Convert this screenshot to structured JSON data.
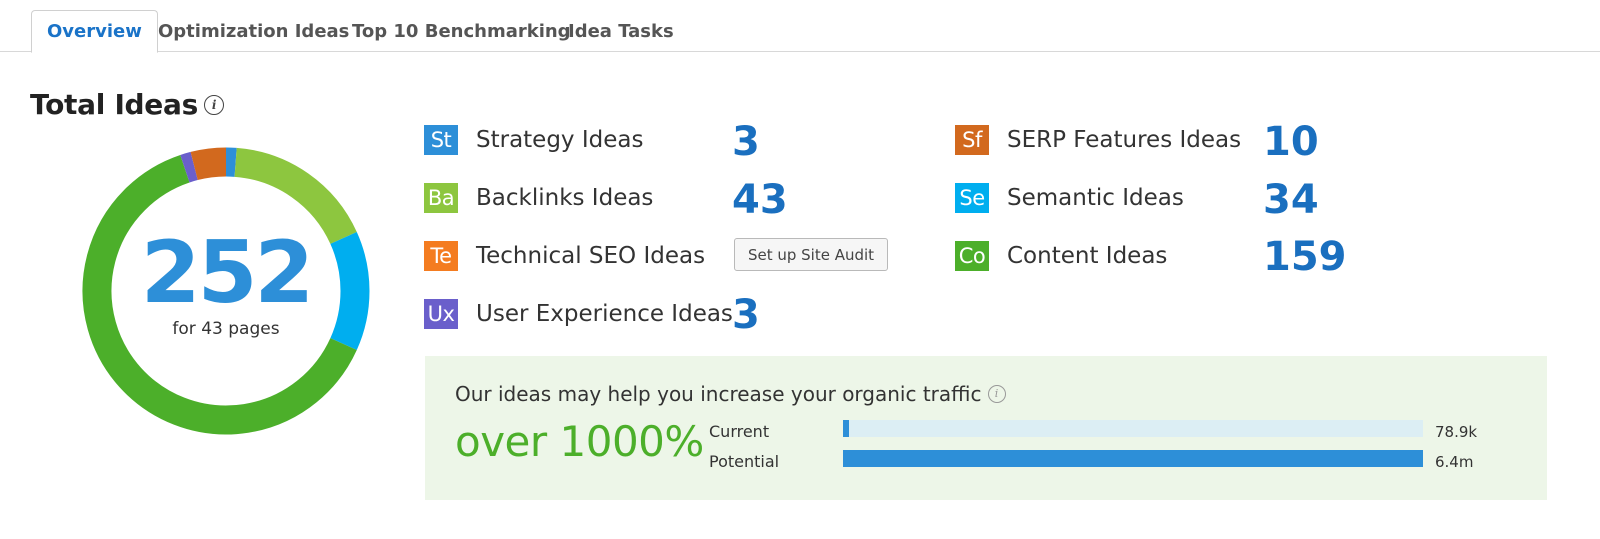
{
  "tabs": [
    {
      "label": "Overview",
      "active": true
    },
    {
      "label": "Optimization Ideas",
      "active": false
    },
    {
      "label": "Top 10 Benchmarking",
      "active": false
    },
    {
      "label": "Idea Tasks",
      "active": false
    }
  ],
  "summary": {
    "title": "Total Ideas",
    "total": "252",
    "pages_label": "for 43 pages"
  },
  "ideas": [
    {
      "badge": "St",
      "label": "Strategy Ideas",
      "count": "3",
      "color": "#2d8fd8"
    },
    {
      "badge": "Ba",
      "label": "Backlinks Ideas",
      "count": "43",
      "color": "#8dc63f"
    },
    {
      "badge": "Te",
      "label": "Technical SEO Ideas",
      "count": "",
      "color": "#f47c20"
    },
    {
      "badge": "Ux",
      "label": "User Experience Ideas",
      "count": "3",
      "color": "#6a5fcb"
    },
    {
      "badge": "Sf",
      "label": "SERP Features Ideas",
      "count": "10",
      "color": "#d2691e"
    },
    {
      "badge": "Se",
      "label": "Semantic Ideas",
      "count": "34",
      "color": "#00aeef"
    },
    {
      "badge": "Co",
      "label": "Content Ideas",
      "count": "159",
      "color": "#4caf2a"
    }
  ],
  "site_audit_button": "Set up Site Audit",
  "donut": {
    "segments": [
      {
        "name": "Strategy",
        "value": 3,
        "color": "#2d8fd8"
      },
      {
        "name": "Backlinks",
        "value": 43,
        "color": "#8dc63f"
      },
      {
        "name": "Semantic",
        "value": 34,
        "color": "#00aeef"
      },
      {
        "name": "Content",
        "value": 159,
        "color": "#4caf2a"
      },
      {
        "name": "User Experience",
        "value": 3,
        "color": "#6a5fcb"
      },
      {
        "name": "SERP Features",
        "value": 10,
        "color": "#d2691e"
      }
    ]
  },
  "traffic": {
    "heading": "Our ideas may help you increase your organic traffic",
    "increase": "over 1000%",
    "bars": [
      {
        "label": "Current",
        "value": "78.9k",
        "fraction": 0.009
      },
      {
        "label": "Potential",
        "value": "6.4m",
        "fraction": 1.0
      }
    ]
  },
  "colors": {
    "accent_blue": "#1a73c8",
    "count_blue": "#1a6fbf",
    "panel_bg": "#edf6e8",
    "traffic_green": "#4caf2a",
    "bar_fill": "#2d8fd8",
    "bar_track": "#dceef4"
  },
  "icons": {
    "info": "info-circle-icon"
  }
}
